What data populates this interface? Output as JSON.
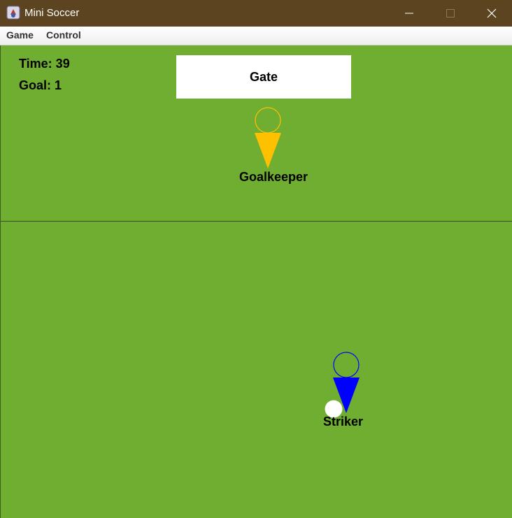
{
  "window": {
    "title": "Mini Soccer",
    "controls": [
      "minimize-icon",
      "maximize-icon",
      "close-icon"
    ]
  },
  "menu": {
    "items": [
      {
        "label": "Game"
      },
      {
        "label": "Control"
      }
    ]
  },
  "hud": {
    "time_text": "Time: 39",
    "goal_text": "Goal: 1"
  },
  "field": {
    "color": "#6fae31",
    "gate_label": "Gate",
    "goalkeeper": {
      "label": "Goalkeeper",
      "color": "#ffc000"
    },
    "striker": {
      "label": "Striker",
      "color": "#0000ff"
    },
    "ball_color": "#ffffff"
  }
}
